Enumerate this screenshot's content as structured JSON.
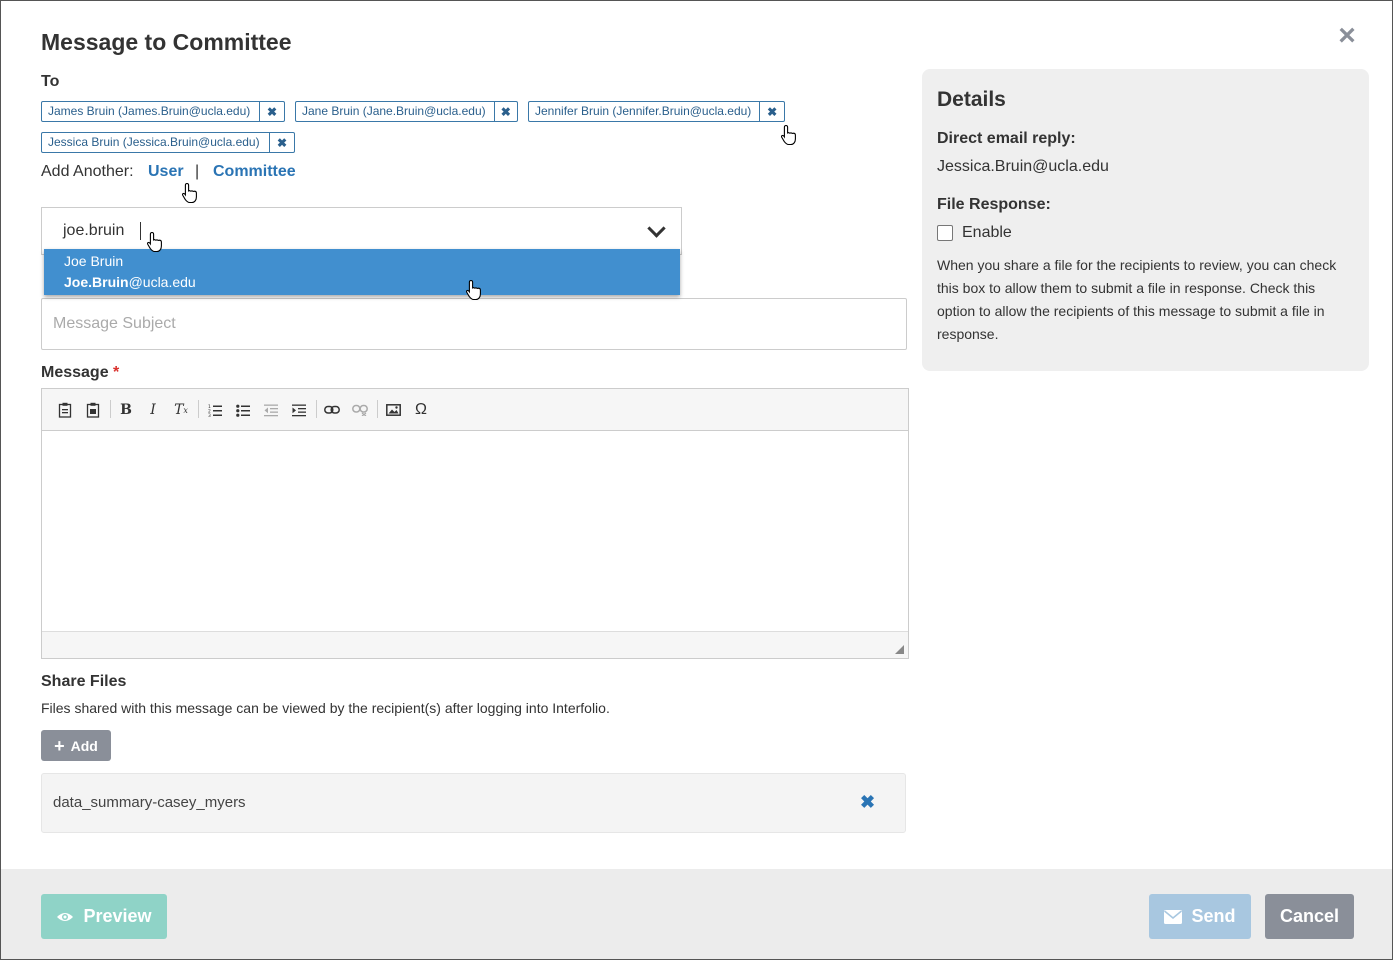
{
  "title": "Message to Committee",
  "to": {
    "label": "To",
    "recipients": [
      "James Bruin (James.Bruin@ucla.edu)",
      "Jane Bruin (Jane.Bruin@ucla.edu)",
      "Jennifer Bruin (Jennifer.Bruin@ucla.edu)",
      "Jessica Bruin (Jessica.Bruin@ucla.edu)"
    ],
    "remove_glyph": "✖",
    "add_another_label": "Add Another:",
    "user_link": "User",
    "separator": "|",
    "committee_link": "Committee"
  },
  "search": {
    "value": "joe.bruin",
    "suggestion": {
      "name": "Joe Bruin",
      "email_match": "Joe.Bruin",
      "email_rest": "@ucla.edu"
    }
  },
  "subject": {
    "placeholder": "Message Subject"
  },
  "message": {
    "label": "Message",
    "required_mark": "*"
  },
  "share": {
    "label": "Share Files",
    "description": "Files shared with this message can be viewed by the recipient(s) after logging into Interfolio.",
    "add_label": "Add",
    "files": [
      "data_summary-casey_myers"
    ]
  },
  "details": {
    "heading": "Details",
    "reply_label": "Direct email reply:",
    "reply_value": "Jessica.Bruin@ucla.edu",
    "file_response_label": "File Response:",
    "enable_label": "Enable",
    "description": "When you share a file for the recipients to review, you can check this box to allow them to submit a file in response. Check this option to allow the recipients of this message to submit a file in response."
  },
  "footer": {
    "preview_label": "Preview",
    "send_label": "Send",
    "cancel_label": "Cancel"
  },
  "colors": {
    "link": "#2a74b4",
    "highlight": "#418fcf",
    "preview_button": "#8fd3c7",
    "send_button": "#a8c7e0",
    "cancel_button": "#8a8f99"
  }
}
